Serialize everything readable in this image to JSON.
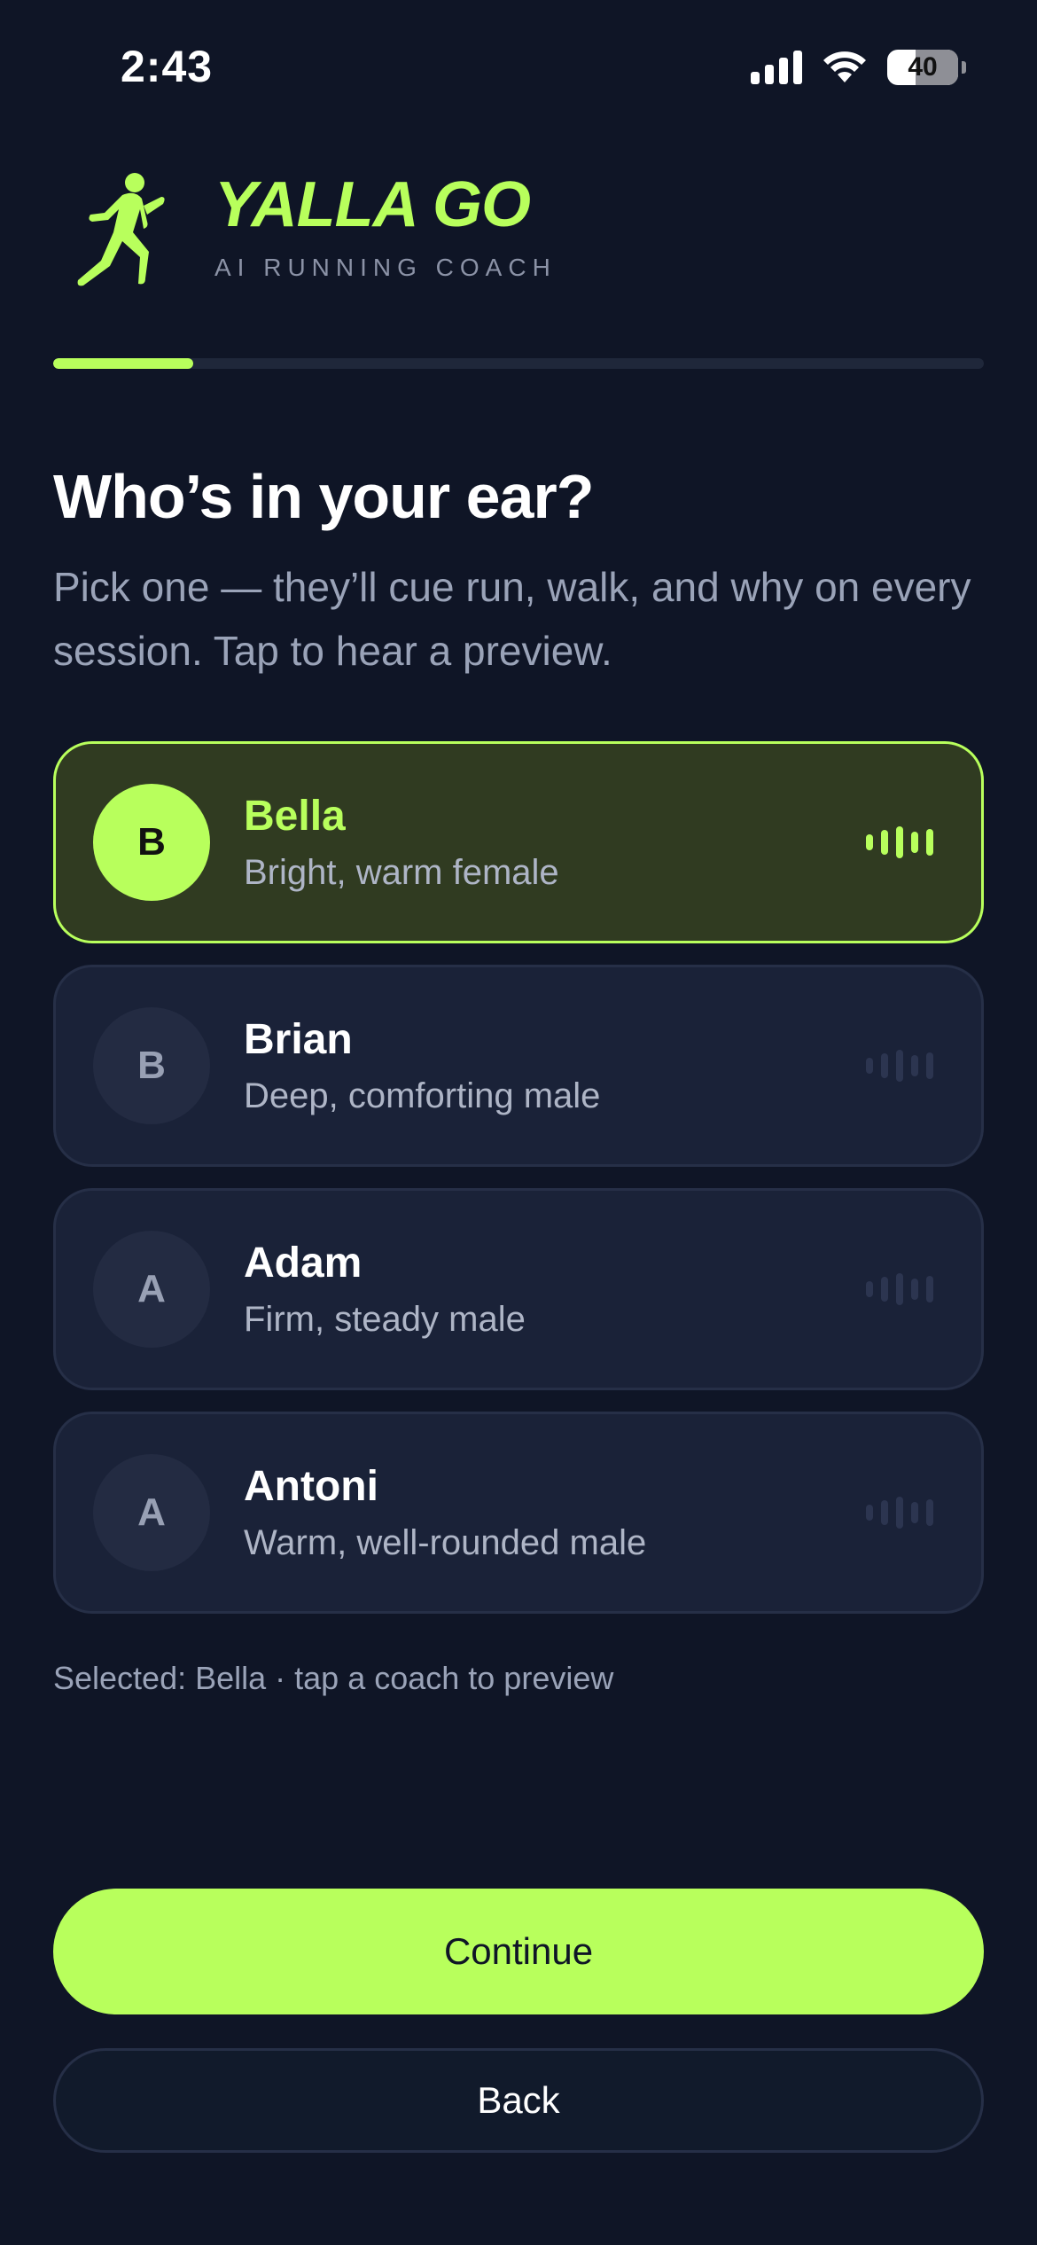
{
  "status_bar": {
    "time": "2:43",
    "battery": "40",
    "battery_level": 0.4
  },
  "brand": {
    "title": "YALLA GO",
    "subtitle": "AI RUNNING COACH",
    "logo_icon": "runner-icon"
  },
  "onboarding_progress": 0.15,
  "header": {
    "title": "Who’s in your ear?",
    "subtitle": "Pick one — they’ll cue run, walk, and why on every session. Tap to hear a preview."
  },
  "coaches": [
    {
      "initial": "B",
      "name": "Bella",
      "description": "Bright, warm female",
      "selected": true
    },
    {
      "initial": "B",
      "name": "Brian",
      "description": "Deep, comforting male",
      "selected": false
    },
    {
      "initial": "A",
      "name": "Adam",
      "description": "Firm, steady male",
      "selected": false
    },
    {
      "initial": "A",
      "name": "Antoni",
      "description": "Warm, well-rounded male",
      "selected": false
    }
  ],
  "selection_note": "Selected: Bella · tap a coach to preview",
  "buttons": {
    "continue": "Continue",
    "back": "Back"
  },
  "colors": {
    "accent": "#b8ff5c",
    "background": "#0f1526",
    "card": "#1a2238",
    "card_selected": "#303b21"
  }
}
